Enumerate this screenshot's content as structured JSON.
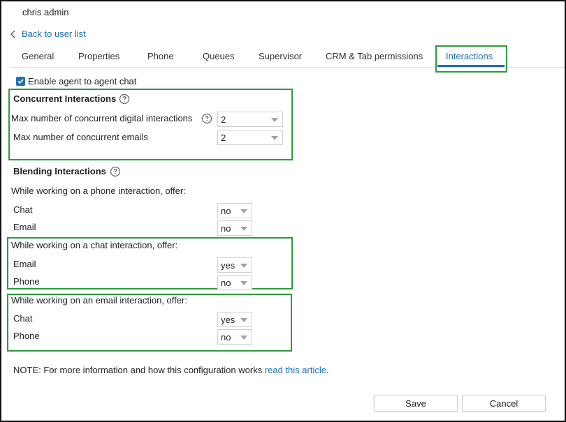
{
  "header": {
    "user_name": "chris admin",
    "back_label": "Back to user list"
  },
  "tabs": [
    {
      "label": "General"
    },
    {
      "label": "Properties"
    },
    {
      "label": "Phone"
    },
    {
      "label": "Queues"
    },
    {
      "label": "Supervisor"
    },
    {
      "label": "CRM & Tab permissions"
    },
    {
      "label": "Interactions",
      "active": true
    }
  ],
  "agent_chat": {
    "label": "Enable agent to agent chat",
    "checked": true
  },
  "concurrent": {
    "title": "Concurrent Interactions",
    "digital_label": "Max number of concurrent digital interactions",
    "digital_value": "2",
    "emails_label": "Max number of concurrent emails",
    "emails_value": "2"
  },
  "blending": {
    "title": "Blending Interactions",
    "phone_heading": "While working on a phone interaction, offer:",
    "phone_chat_label": "Chat",
    "phone_chat_value": "no",
    "phone_email_label": "Email",
    "phone_email_value": "no",
    "chat_heading": "While working on a chat interaction, offer:",
    "chat_email_label": "Email",
    "chat_email_value": "yes",
    "chat_phone_label": "Phone",
    "chat_phone_value": "no",
    "email_heading": "While working on an email interaction, offer:",
    "email_chat_label": "Chat",
    "email_chat_value": "yes",
    "email_phone_label": "Phone",
    "email_phone_value": "no"
  },
  "note": {
    "text": "NOTE: For more information and how this configuration works ",
    "link": "read this article",
    "suffix": "."
  },
  "actions": {
    "save": "Save",
    "cancel": "Cancel"
  },
  "colors": {
    "accent": "#1a6fb5",
    "highlight": "#2e9b3b"
  },
  "icons": {
    "back": "chevron-left-icon",
    "help": "question-circle-icon",
    "check": "checkmark-icon",
    "dropdown": "caret-down-icon"
  }
}
